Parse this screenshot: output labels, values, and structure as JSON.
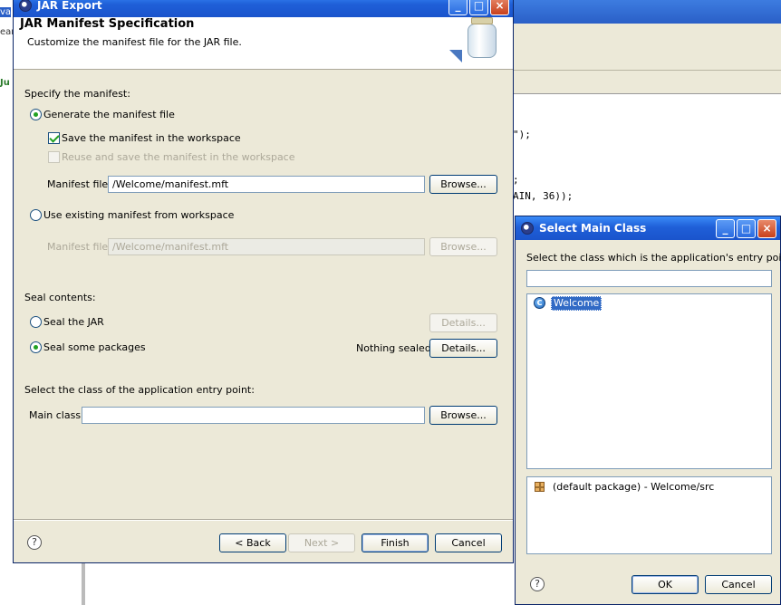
{
  "background": {
    "left_fragments": [
      "va",
      "ear",
      "Ju"
    ],
    "code_lines": [
      "\");",
      ";",
      "AIN, 36));"
    ]
  },
  "jar_export": {
    "title": "JAR Export",
    "header_title": "JAR Manifest Specification",
    "header_desc": "Customize the manifest file for the JAR file.",
    "specify_label": "Specify the manifest:",
    "generate_label": "Generate the manifest file",
    "generate_selected": true,
    "save_label": "Save the manifest in the workspace",
    "save_checked": true,
    "reuse_label": "Reuse and save the manifest in the workspace",
    "reuse_checked": false,
    "manifest_file_label": "Manifest file:",
    "manifest_file_value": "/Welcome/manifest.mft",
    "browse_label": "Browse...",
    "use_existing_label": "Use existing manifest from workspace",
    "use_existing_selected": false,
    "manifest_file2_label": "Manifest file:",
    "manifest_file2_value": "/Welcome/manifest.mft",
    "browse2_label": "Browse...",
    "seal_label": "Seal contents:",
    "seal_jar_label": "Seal the JAR",
    "seal_jar_selected": false,
    "details_label": "Details...",
    "seal_packages_label": "Seal some packages",
    "seal_packages_selected": true,
    "nothing_sealed": "Nothing sealed",
    "details2_label": "Details...",
    "entry_point_label": "Select the class of the application entry point:",
    "main_class_label": "Main class:",
    "main_class_value": "",
    "browse3_label": "Browse...",
    "help_symbol": "?",
    "back_label": "< Back",
    "next_label": "Next >",
    "finish_label": "Finish",
    "cancel_label": "Cancel"
  },
  "select_main": {
    "title": "Select Main Class",
    "prompt": "Select the class which is the application's entry point:",
    "filter_value": "",
    "classes": [
      {
        "icon": "class-icon",
        "name": "Welcome",
        "selected": true
      }
    ],
    "packages": [
      {
        "icon": "package-icon",
        "name": "(default package) - Welcome/src"
      }
    ],
    "help_symbol": "?",
    "ok_label": "OK",
    "cancel_label": "Cancel"
  },
  "colors": {
    "title_bar": "#1f5fd8",
    "selection": "#316ac5",
    "dialog_bg": "#ece9d8"
  }
}
